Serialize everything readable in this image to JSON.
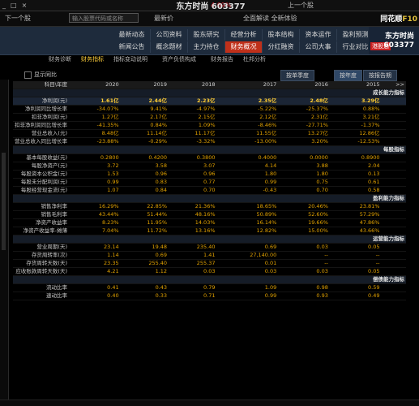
{
  "topbar": {
    "window_controls": [
      "_",
      "□",
      "×"
    ],
    "stock_title": "东方时尚 603377",
    "quote_change": "4.69%",
    "latest_label": "最新价",
    "prev_next": [
      "上一个股",
      "下一个股"
    ],
    "search_placeholder": "输入股票代码或名称"
  },
  "toolbar": {
    "items": [
      "最新价",
      "全面解读 全新体验"
    ],
    "brand_text": "同花顺",
    "brand_f10": "F10"
  },
  "nav": {
    "stock_name": "东方时尚",
    "stock_code": "603377",
    "tag": "港股通",
    "row1": [
      "最新动态",
      "公司资料",
      "股东研究",
      "经营分析",
      "股本结构",
      "资本运作",
      "盈利预测"
    ],
    "row2": [
      "新闻公告",
      "概念题材",
      "主力持仓",
      "财务概况",
      "分红融资",
      "公司大事",
      "行业对比"
    ],
    "active": "财务概况"
  },
  "subtabs": {
    "items": [
      "财务诊断",
      "财务指标",
      "指标变动说明",
      "资产负债构成",
      "财务报告",
      "杜邦分析"
    ],
    "active": "财务指标"
  },
  "controls": {
    "btn_report": "按报告期",
    "btn_year": "按年度",
    "btn_quarter": "按单季度",
    "chk_label": "显示同比"
  },
  "table": {
    "header": [
      "科目\\年度",
      "2020",
      "2019",
      "2018",
      "2017",
      "2016",
      "2015",
      ">>"
    ],
    "rows": [
      {
        "type": "sec",
        "label": "成长能力指标",
        "values": []
      },
      {
        "type": "hi",
        "label": "净利润(元)",
        "values": [
          "1.61亿",
          "2.44亿",
          "2.23亿",
          "2.35亿",
          "2.48亿",
          "3.29亿"
        ]
      },
      {
        "type": "row",
        "label": "净利润同比增长率",
        "values": [
          "-34.07%",
          "9.41%",
          "-4.97%",
          "-5.22%",
          "-25.37%",
          "0.88%"
        ]
      },
      {
        "type": "row",
        "label": "扣非净利润(元)",
        "values": [
          "1.27亿",
          "2.17亿",
          "2.15亿",
          "2.12亿",
          "2.31亿",
          "3.21亿"
        ]
      },
      {
        "type": "row",
        "label": "扣非净利润同比增长率",
        "values": [
          "-41.35%",
          "0.84%",
          "1.09%",
          "-8.46%",
          "-27.71%",
          "-1.37%"
        ]
      },
      {
        "type": "row",
        "label": "营业总收入(元)",
        "values": [
          "8.48亿",
          "11.14亿",
          "11.17亿",
          "11.55亿",
          "13.27亿",
          "12.86亿"
        ]
      },
      {
        "type": "row",
        "label": "营业总收入同比增长率",
        "values": [
          "-23.88%",
          "-0.29%",
          "-3.32%",
          "-13.00%",
          "3.20%",
          "-12.53%"
        ]
      },
      {
        "type": "sec",
        "label": "每股指标",
        "values": []
      },
      {
        "type": "row",
        "label": "基本每股收益(元)",
        "values": [
          "0.2800",
          "0.4200",
          "0.3800",
          "0.4000",
          "0.0000",
          "0.8900"
        ]
      },
      {
        "type": "row",
        "label": "每股净资产(元)",
        "values": [
          "3.72",
          "3.58",
          "3.07",
          "4.14",
          "3.88",
          "2.04"
        ]
      },
      {
        "type": "row",
        "label": "每股资本公积金(元)",
        "values": [
          "1.53",
          "0.96",
          "0.96",
          "1.80",
          "1.80",
          "0.13"
        ]
      },
      {
        "type": "row",
        "label": "每股未分配利润(元)",
        "values": [
          "0.99",
          "0.83",
          "0.77",
          "0.99",
          "0.75",
          "0.61"
        ]
      },
      {
        "type": "row",
        "label": "每股经营现金流(元)",
        "values": [
          "1.07",
          "0.84",
          "0.70",
          "-0.43",
          "0.70",
          "0.58"
        ]
      },
      {
        "type": "sec",
        "label": "盈利能力指标",
        "values": []
      },
      {
        "type": "row",
        "label": "销售净利率",
        "values": [
          "16.29%",
          "22.85%",
          "21.36%",
          "18.65%",
          "20.46%",
          "23.81%"
        ]
      },
      {
        "type": "row",
        "label": "销售毛利率",
        "values": [
          "43.44%",
          "51.44%",
          "48.16%",
          "50.89%",
          "52.60%",
          "57.29%"
        ]
      },
      {
        "type": "row",
        "label": "净资产收益率",
        "values": [
          "8.23%",
          "11.95%",
          "14.03%",
          "16.14%",
          "19.66%",
          "47.86%"
        ]
      },
      {
        "type": "row",
        "label": "净资产收益率-摊薄",
        "values": [
          "7.04%",
          "11.72%",
          "13.16%",
          "12.82%",
          "15.00%",
          "43.66%"
        ]
      },
      {
        "type": "sec",
        "label": "运营能力指标",
        "values": []
      },
      {
        "type": "row",
        "label": "营业周期(天)",
        "values": [
          "23.14",
          "19.48",
          "235.40",
          "0.69",
          "0.03",
          "0.05"
        ]
      },
      {
        "type": "row",
        "label": "存货周转率(次)",
        "values": [
          "1.14",
          "0.69",
          "1.41",
          "27,140.00",
          "--",
          "--"
        ]
      },
      {
        "type": "row",
        "label": "存货周转天数(天)",
        "values": [
          "23.35",
          "255.40",
          "255.37",
          "0.01",
          "--",
          "--"
        ]
      },
      {
        "type": "row",
        "label": "应收账款周转天数(天)",
        "values": [
          "4.21",
          "1.12",
          "0.03",
          "0.03",
          "0.03",
          "0.05"
        ]
      },
      {
        "type": "sec",
        "label": "偿债能力指标",
        "values": []
      },
      {
        "type": "row",
        "label": "流动比率",
        "values": [
          "0.41",
          "0.43",
          "0.79",
          "1.09",
          "0.98",
          "0.59"
        ]
      },
      {
        "type": "row",
        "label": "速动比率",
        "values": [
          "0.40",
          "0.33",
          "0.71",
          "0.99",
          "0.93",
          "0.49"
        ]
      }
    ]
  }
}
